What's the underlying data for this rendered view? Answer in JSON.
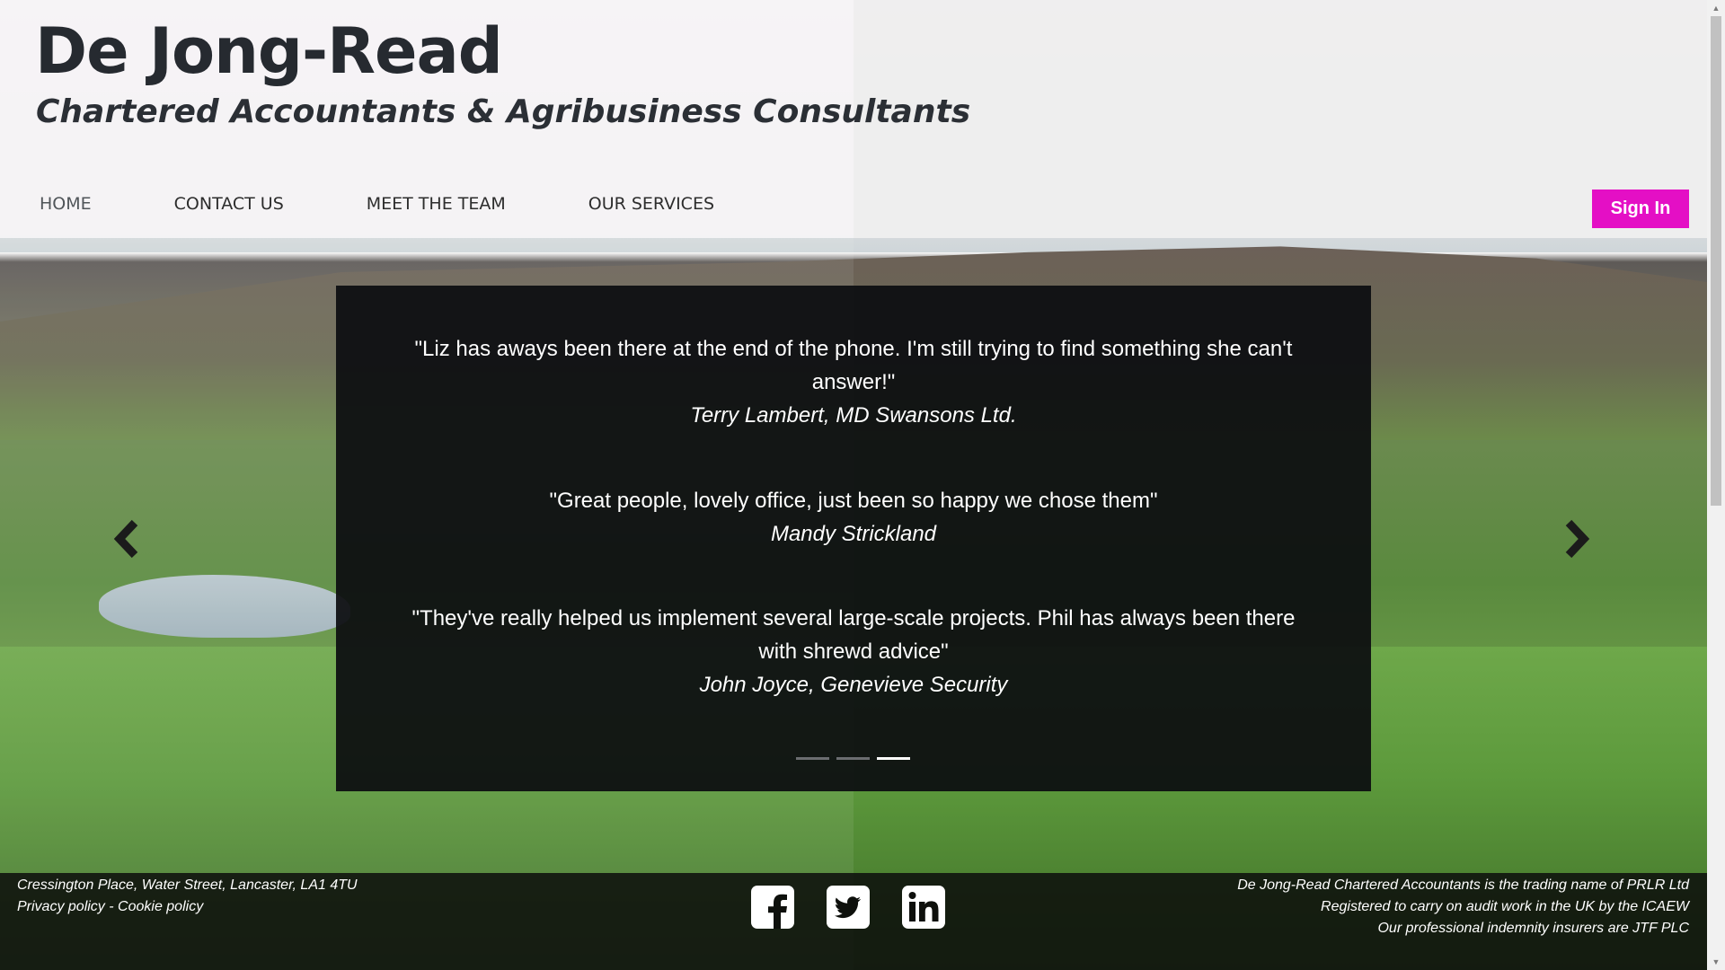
{
  "site": {
    "title": "De Jong-Read",
    "tagline": "Chartered Accountants & Agribusiness Consultants"
  },
  "nav": {
    "items": [
      {
        "label": "HOME",
        "active": true
      },
      {
        "label": "CONTACT US",
        "active": false
      },
      {
        "label": "MEET THE TEAM",
        "active": false
      },
      {
        "label": "OUR SERVICES",
        "active": false
      }
    ],
    "signin_label": "Sign In"
  },
  "carousel": {
    "testimonials": [
      {
        "quote": "\"Liz has aways been there at the end of the phone. I'm still trying to find something she can't answer!\"",
        "author": "Terry Lambert, MD Swansons Ltd."
      },
      {
        "quote": "\"Great people, lovely office, just been so happy we chose them\"",
        "author": "Mandy Strickland"
      },
      {
        "quote": "\"They've really helped us implement several large-scale projects. Phil has always been there with shrewd advice\"",
        "author": "John Joyce, Genevieve Security"
      }
    ],
    "slide_count": 3,
    "active_slide": 3,
    "prev_icon": "chevron-left-icon",
    "next_icon": "chevron-right-icon"
  },
  "footer": {
    "address": "Cressington Place, Water Street, Lancaster, LA1 4TU",
    "privacy_label": "Privacy policy",
    "separator": " - ",
    "cookie_label": "Cookie policy",
    "social": [
      "facebook-icon",
      "twitter-icon",
      "linkedin-icon"
    ],
    "legal_lines": [
      "De Jong-Read Chartered Accountants is the trading name of PRLR Ltd",
      "Registered to carry on audit work in the UK by the ICAEW",
      "Our professional indemnity insurers are JTF PLC"
    ]
  },
  "colors": {
    "accent": "#e40fc5",
    "carousel_bg": "#0c0d10",
    "footer_bg": "#0e100c"
  }
}
